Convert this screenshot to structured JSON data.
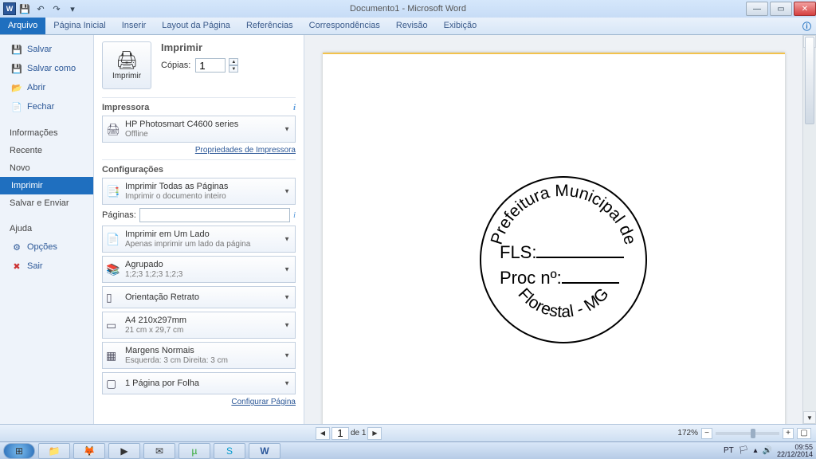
{
  "title": "Documento1  -  Microsoft Word",
  "ribbon": {
    "file": "Arquivo",
    "tabs": [
      "Página Inicial",
      "Inserir",
      "Layout da Página",
      "Referências",
      "Correspondências",
      "Revisão",
      "Exibição"
    ]
  },
  "sidebar": {
    "save": "Salvar",
    "saveas": "Salvar como",
    "open": "Abrir",
    "close": "Fechar",
    "info": "Informações",
    "recent": "Recente",
    "new": "Novo",
    "print": "Imprimir",
    "saveSend": "Salvar e Enviar",
    "help": "Ajuda",
    "options": "Opções",
    "exit": "Sair"
  },
  "print": {
    "heading": "Imprimir",
    "bigbtn": "Imprimir",
    "copies_label": "Cópias:",
    "copies_value": "1",
    "printer_h": "Impressora",
    "printer_name": "HP Photosmart C4600 series",
    "printer_status": "Offline",
    "printer_props": "Propriedades de Impressora",
    "config_h": "Configurações",
    "all_pages_t": "Imprimir Todas as Páginas",
    "all_pages_s": "Imprimir o documento inteiro",
    "pages_label": "Páginas:",
    "oneside_t": "Imprimir em Um Lado",
    "oneside_s": "Apenas imprimir um lado da página",
    "collate_t": "Agrupado",
    "collate_s": "1;2;3    1;2;3    1;2;3",
    "orient_t": "Orientação Retrato",
    "paper_t": "A4 210x297mm",
    "paper_s": "21 cm x 29,7 cm",
    "margins_t": "Margens Normais",
    "margins_s": "Esquerda:  3 cm    Direita:  3 cm",
    "ppp_t": "1 Página por Folha",
    "page_setup": "Configurar Página"
  },
  "doc": {
    "arc_top": "Prefeitura Municipal de",
    "arc_bottom": "Florestal - MG",
    "line1_label": "FLS:",
    "line2_label": "Proc nº:"
  },
  "status": {
    "page_cur": "1",
    "page_of": "de 1",
    "zoom": "172%"
  },
  "taskbar": {
    "lang": "PT",
    "time": "09:55",
    "date": "22/12/2014"
  }
}
